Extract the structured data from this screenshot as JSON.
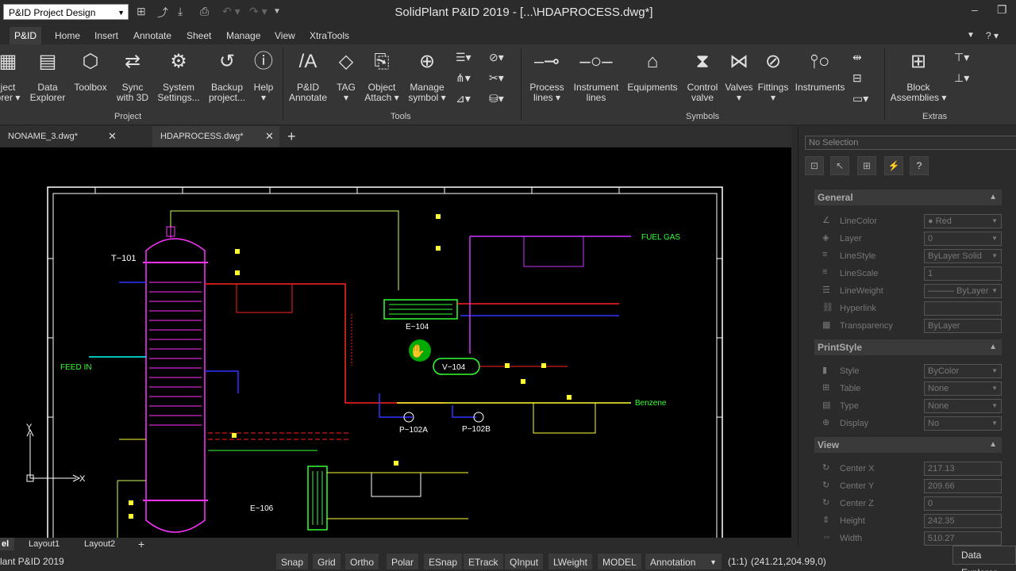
{
  "titlebar": {
    "workspace": "P&ID Project Design",
    "window_title": "SolidPlant P&ID 2019 - [...\\HDAPROCESS.dwg*]"
  },
  "ribbon_tabs": [
    "P&ID",
    "Home",
    "Insert",
    "Annotate",
    "Sheet",
    "Manage",
    "View",
    "XtraTools"
  ],
  "ribbon": {
    "project": {
      "label": "Project",
      "buttons": [
        {
          "l1": "ject",
          "l2": "orer ▾",
          "icon": "project-explorer-icon"
        },
        {
          "l1": "Data",
          "l2": "Explorer",
          "icon": "data-explorer-icon"
        },
        {
          "l1": "Toolbox",
          "l2": "",
          "icon": "toolbox-icon"
        },
        {
          "l1": "Sync",
          "l2": "with 3D",
          "icon": "sync-icon"
        },
        {
          "l1": "System",
          "l2": "Settings...",
          "icon": "gear-icon"
        },
        {
          "l1": "Backup",
          "l2": "project...",
          "icon": "history-icon"
        },
        {
          "l1": "Help",
          "l2": "▾",
          "icon": "info-icon"
        }
      ]
    },
    "tools": {
      "label": "Tools",
      "buttons": [
        {
          "l1": "P&ID",
          "l2": "Annotate",
          "icon": "annotate-icon"
        },
        {
          "l1": "TAG",
          "l2": "▾",
          "icon": "tag-icon"
        },
        {
          "l1": "Object",
          "l2": "Attach ▾",
          "icon": "attach-icon"
        },
        {
          "l1": "Manage",
          "l2": "symbol ▾",
          "icon": "symbol-icon"
        }
      ]
    },
    "symbols": {
      "label": "Symbols",
      "buttons": [
        {
          "l1": "Process",
          "l2": "lines ▾",
          "icon": "process-line-icon"
        },
        {
          "l1": "Instrument",
          "l2": "lines",
          "icon": "instrument-line-icon"
        },
        {
          "l1": "Equipments",
          "l2": "",
          "icon": "equipment-icon"
        },
        {
          "l1": "Control",
          "l2": "valve",
          "icon": "control-valve-icon"
        },
        {
          "l1": "Valves",
          "l2": "▾",
          "icon": "valve-icon"
        },
        {
          "l1": "Fittings",
          "l2": "▾",
          "icon": "fitting-icon"
        },
        {
          "l1": "Instruments",
          "l2": "",
          "icon": "instrument-icon"
        }
      ]
    },
    "extras": {
      "label": "Extras",
      "buttons": [
        {
          "l1": "Block",
          "l2": "Assemblies ▾",
          "icon": "block-icon"
        }
      ]
    }
  },
  "doc_tabs": [
    "NONAME_3.dwg*",
    "HDAPROCESS.dwg*"
  ],
  "drawing": {
    "labels": {
      "t101": "T−101",
      "e104": "E−104",
      "v104": "V−104",
      "feed": "FEED IN",
      "fuel": "FUEL GAS",
      "benzene": "Benzene",
      "p102a": "P−102A",
      "p102b": "P−102B",
      "e106": "E−106",
      "ucs_y": "Y",
      "ucs_x": "X"
    }
  },
  "properties": {
    "selection": "No Selection",
    "general": {
      "title": "General",
      "rows": [
        {
          "label": "LineColor",
          "value": "● Red",
          "icon": "line-color-icon"
        },
        {
          "label": "Layer",
          "value": "0",
          "icon": "layer-icon"
        },
        {
          "label": "LineStyle",
          "value": "ByLayer    Solid",
          "icon": "linestyle-icon"
        },
        {
          "label": "LineScale",
          "value": "1",
          "icon": "linescale-icon"
        },
        {
          "label": "LineWeight",
          "value": "——— ByLayer",
          "icon": "lineweight-icon"
        },
        {
          "label": "Hyperlink",
          "value": "",
          "icon": "link-icon"
        },
        {
          "label": "Transparency",
          "value": "ByLayer",
          "icon": "transparency-icon"
        }
      ]
    },
    "printstyle": {
      "title": "PrintStyle",
      "rows": [
        {
          "label": "Style",
          "value": "ByColor",
          "icon": "style-icon"
        },
        {
          "label": "Table",
          "value": "None",
          "icon": "table-icon"
        },
        {
          "label": "Type",
          "value": "None",
          "icon": "type-icon"
        },
        {
          "label": "Display",
          "value": "No",
          "icon": "display-icon"
        }
      ]
    },
    "view": {
      "title": "View",
      "rows": [
        {
          "label": "Center X",
          "value": "217.13",
          "icon": "center-icon"
        },
        {
          "label": "Center Y",
          "value": "209.66",
          "icon": "center-icon"
        },
        {
          "label": "Center Z",
          "value": "0",
          "icon": "center-icon"
        },
        {
          "label": "Height",
          "value": "242.35",
          "icon": "height-icon"
        },
        {
          "label": "Width",
          "value": "510.27",
          "icon": "width-icon"
        }
      ]
    }
  },
  "layout_tabs": [
    "el",
    "Layout1",
    "Layout2"
  ],
  "statusbar": {
    "app": "lant P&ID 2019",
    "buttons": [
      "Snap",
      "Grid",
      "Ortho",
      "Polar",
      "ESnap",
      "ETrack",
      "QInput",
      "LWeight",
      "MODEL"
    ],
    "annotation": "Annotation",
    "scale": "(1:1)",
    "coords": "(241.21,204.99,0)"
  },
  "data_explorer_tab": "Data Explorer"
}
